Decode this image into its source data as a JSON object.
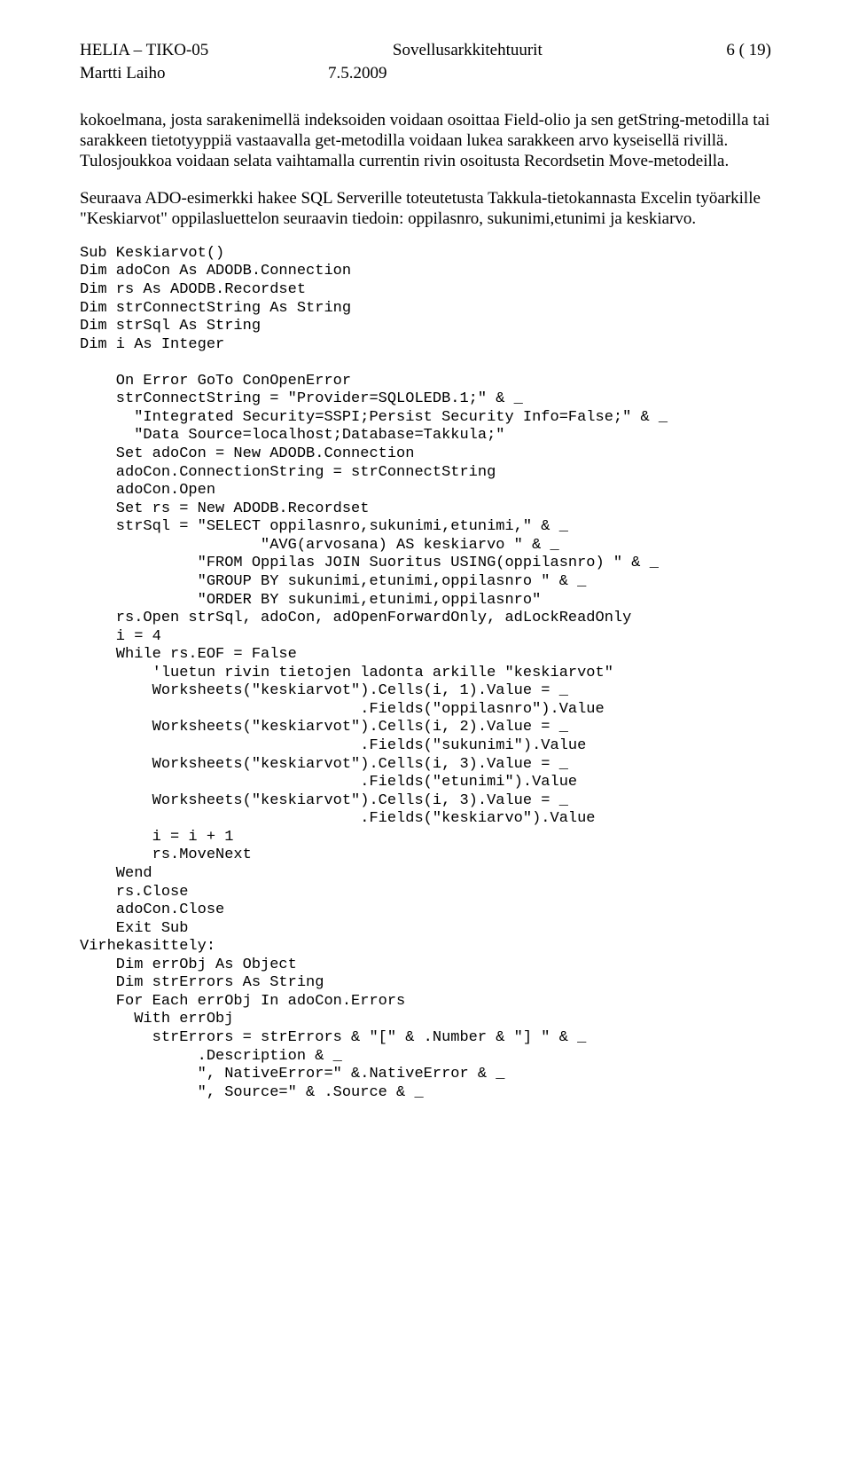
{
  "header": {
    "left": "HELIA – TIKO-05",
    "center": "Sovellusarkkitehtuurit",
    "right": "6 ( 19)"
  },
  "subheader": {
    "author": "Martti Laiho",
    "date": "7.5.2009"
  },
  "para1": "kokoelmana, josta sarakenimellä indeksoiden voidaan osoittaa Field-olio ja sen getString-metodilla tai sarakkeen tietotyyppiä vastaavalla get-metodilla voidaan lukea sarakkeen arvo kyseisellä rivillä. Tulosjoukkoa voidaan selata vaihtamalla currentin rivin osoitusta Recordsetin Move-metodeilla.",
  "para2": "Seuraava ADO-esimerkki hakee SQL Serverille toteutetusta Takkula-tietokannasta Excelin työarkille \"Keskiarvot\" oppilasluettelon seuraavin tiedoin: oppilasnro, sukunimi,etunimi ja keskiarvo.",
  "code": "Sub Keskiarvot()\nDim adoCon As ADODB.Connection\nDim rs As ADODB.Recordset\nDim strConnectString As String\nDim strSql As String\nDim i As Integer\n\n    On Error GoTo ConOpenError\n    strConnectString = \"Provider=SQLOLEDB.1;\" & _\n      \"Integrated Security=SSPI;Persist Security Info=False;\" & _\n      \"Data Source=localhost;Database=Takkula;\"\n    Set adoCon = New ADODB.Connection\n    adoCon.ConnectionString = strConnectString\n    adoCon.Open\n    Set rs = New ADODB.Recordset\n    strSql = \"SELECT oppilasnro,sukunimi,etunimi,\" & _\n                    \"AVG(arvosana) AS keskiarvo \" & _\n             \"FROM Oppilas JOIN Suoritus USING(oppilasnro) \" & _\n             \"GROUP BY sukunimi,etunimi,oppilasnro \" & _\n             \"ORDER BY sukunimi,etunimi,oppilasnro\"\n    rs.Open strSql, adoCon, adOpenForwardOnly, adLockReadOnly\n    i = 4\n    While rs.EOF = False\n        'luetun rivin tietojen ladonta arkille \"keskiarvot\"\n        Worksheets(\"keskiarvot\").Cells(i, 1).Value = _\n                               .Fields(\"oppilasnro\").Value\n        Worksheets(\"keskiarvot\").Cells(i, 2).Value = _\n                               .Fields(\"sukunimi\").Value\n        Worksheets(\"keskiarvot\").Cells(i, 3).Value = _\n                               .Fields(\"etunimi\").Value\n        Worksheets(\"keskiarvot\").Cells(i, 3).Value = _\n                               .Fields(\"keskiarvo\").Value\n        i = i + 1\n        rs.MoveNext\n    Wend\n    rs.Close\n    adoCon.Close\n    Exit Sub\nVirhekasittely:\n    Dim errObj As Object\n    Dim strErrors As String\n    For Each errObj In adoCon.Errors\n      With errObj\n        strErrors = strErrors & \"[\" & .Number & \"] \" & _\n             .Description & _\n             \", NativeError=\" &.NativeError & _\n             \", Source=\" & .Source & _"
}
